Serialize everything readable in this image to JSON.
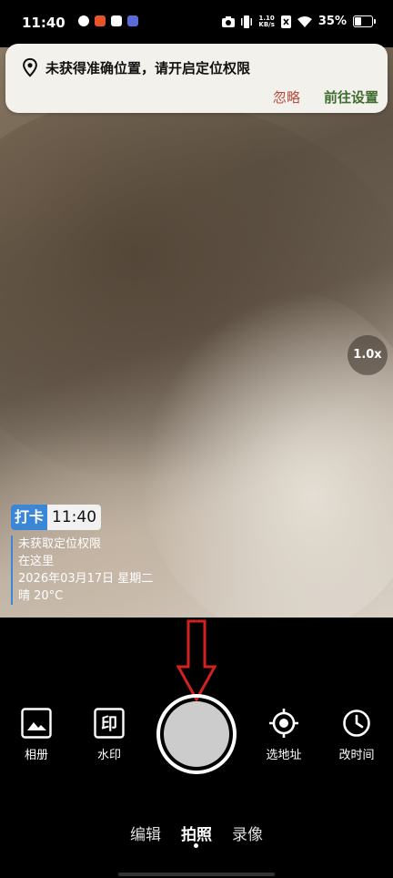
{
  "status_bar": {
    "time": "11:40",
    "net_speed_top": "1.10",
    "net_speed_bottom": "KB/s",
    "battery": "35%",
    "battery_level": 0.35,
    "app_icons": [
      "#e8542a",
      "#ffffff",
      "#5a6bd8",
      "#8a5ad8"
    ]
  },
  "notice": {
    "message": "未获得准确位置，请开启定位权限",
    "ignore_label": "忽略",
    "settings_label": "前往设置"
  },
  "zoom": "1.0x",
  "watermark": {
    "badge": "打卡",
    "time": "11:40",
    "lines": [
      "未获取定位权限",
      "在这里",
      "2026年03月17日 星期二",
      "晴 20°C"
    ]
  },
  "controls": {
    "album": "相册",
    "watermark": "水印",
    "watermark_icon_text": "印",
    "location": "选地址",
    "change_time": "改时间"
  },
  "modes": [
    "编辑",
    "拍照",
    "录像"
  ],
  "active_mode": "拍照",
  "colors": {
    "accent_blue": "#3c86d6",
    "ignore_red": "#b84a3a",
    "settings_green": "#3e6b2e",
    "annotation_red": "#d32020"
  }
}
